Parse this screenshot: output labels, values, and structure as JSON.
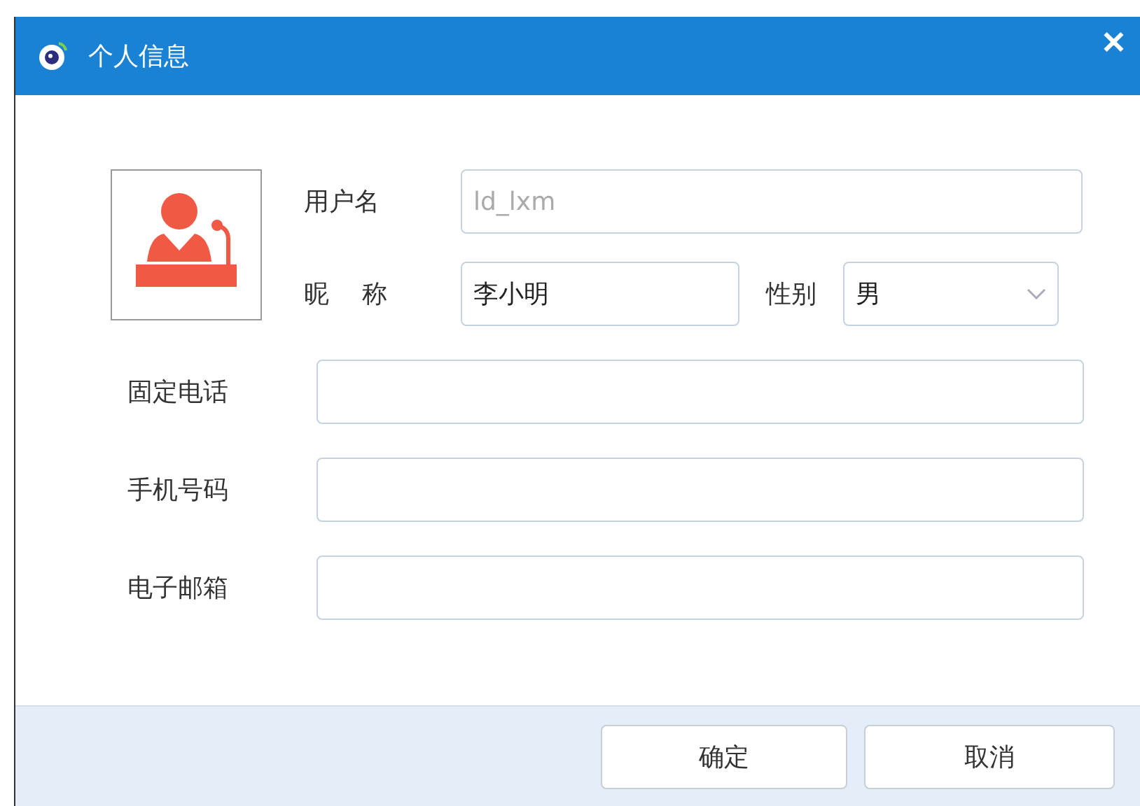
{
  "window": {
    "title": "个人信息",
    "close": "✕"
  },
  "profile": {
    "username": {
      "label": "用户名",
      "value": "ld_lxm",
      "disabled": true
    },
    "nickname": {
      "label": "昵 称",
      "value": "李小明"
    },
    "gender": {
      "label": "性别",
      "value": "男"
    }
  },
  "fields": [
    {
      "label": "固定电话"
    },
    {
      "label": "手机号码"
    },
    {
      "label": "电子邮箱"
    }
  ],
  "buttons": [
    {
      "label": "确定",
      "kind": "primary"
    },
    {
      "label": "取消",
      "kind": "cancel"
    }
  ]
}
